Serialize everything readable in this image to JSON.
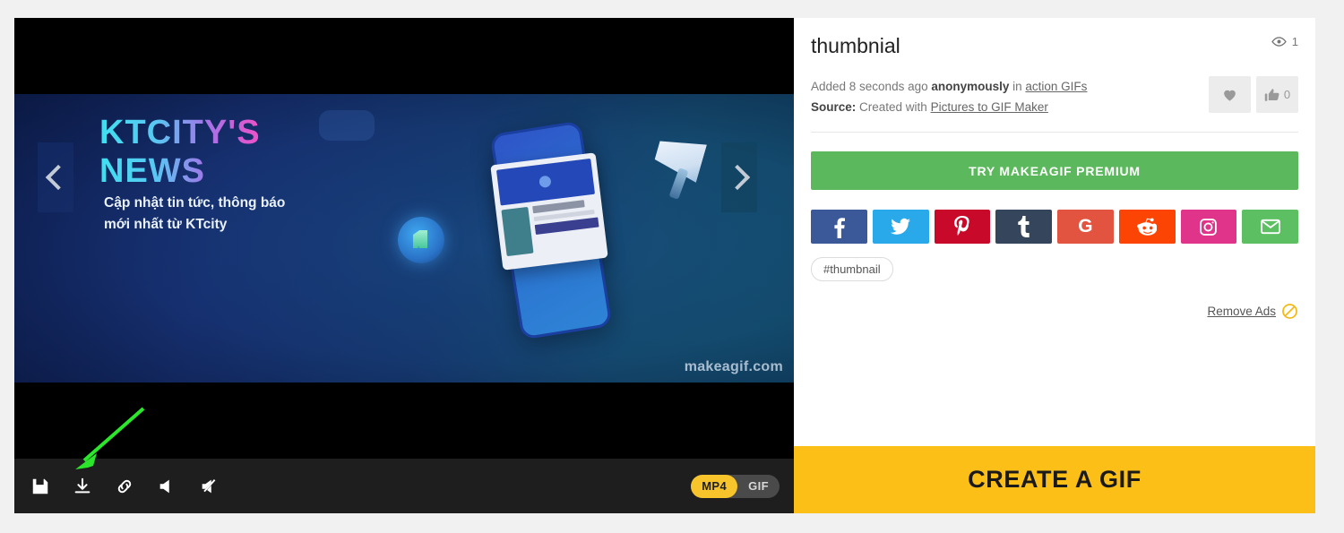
{
  "player": {
    "gif": {
      "headline_line1": "KTCITY'S",
      "headline_line2": "NEWS",
      "subtitle_line1": "Cập nhật tin tức, thông báo",
      "subtitle_line2": "mới nhất từ KTcity",
      "watermark": "makeagif.com"
    },
    "nav": {
      "prev_label": "Previous GIF",
      "next_label": "Next GIF"
    },
    "toolbar": {
      "icons": [
        {
          "name": "save-icon",
          "label": "Save"
        },
        {
          "name": "download-icon",
          "label": "Download"
        },
        {
          "name": "link-icon",
          "label": "Copy link"
        },
        {
          "name": "megaphone-icon",
          "label": "Sound on"
        },
        {
          "name": "megaphone-muted-icon",
          "label": "Sound off"
        }
      ],
      "format_options": [
        {
          "label": "MP4",
          "active": true
        },
        {
          "label": "GIF",
          "active": false
        }
      ]
    },
    "annotation": {
      "name": "green-arrow",
      "color": "#2ce62c",
      "points_to": "download-icon"
    }
  },
  "info": {
    "title": "thumbnial",
    "views_count": "1",
    "meta": {
      "added_prefix": "Added 8 seconds ago ",
      "uploader": "anonymously",
      "in_word": " in ",
      "category": "action GIFs",
      "source_label": "Source:",
      "source_prefix": " Created with ",
      "source_link": "Pictures to GIF Maker"
    },
    "reactions": {
      "heart_label": "Favorite",
      "like_count": "0"
    },
    "premium_button": "TRY MAKEAGIF PREMIUM",
    "socials": [
      {
        "name": "facebook",
        "glyph": "f",
        "color": "#3b5998"
      },
      {
        "name": "twitter",
        "glyph": "",
        "color": "#29a9e9"
      },
      {
        "name": "pinterest",
        "glyph": "",
        "color": "#c8092a"
      },
      {
        "name": "tumblr",
        "glyph": "t",
        "color": "#35465c"
      },
      {
        "name": "google",
        "glyph": "G",
        "color": "#e35440"
      },
      {
        "name": "reddit",
        "glyph": "",
        "color": "#fc4404"
      },
      {
        "name": "instagram",
        "glyph": "",
        "color": "#e0348a"
      },
      {
        "name": "email",
        "glyph": "",
        "color": "#5cbf62"
      }
    ],
    "tags": [
      "#thumbnail"
    ],
    "remove_ads": "Remove Ads ",
    "create_button": "CREATE A GIF"
  },
  "colors": {
    "premium_green": "#5cb85c",
    "create_yellow": "#fbbf18",
    "toolbar_dark": "#1e1e1e",
    "accent_mp4": "#f7c52b"
  }
}
